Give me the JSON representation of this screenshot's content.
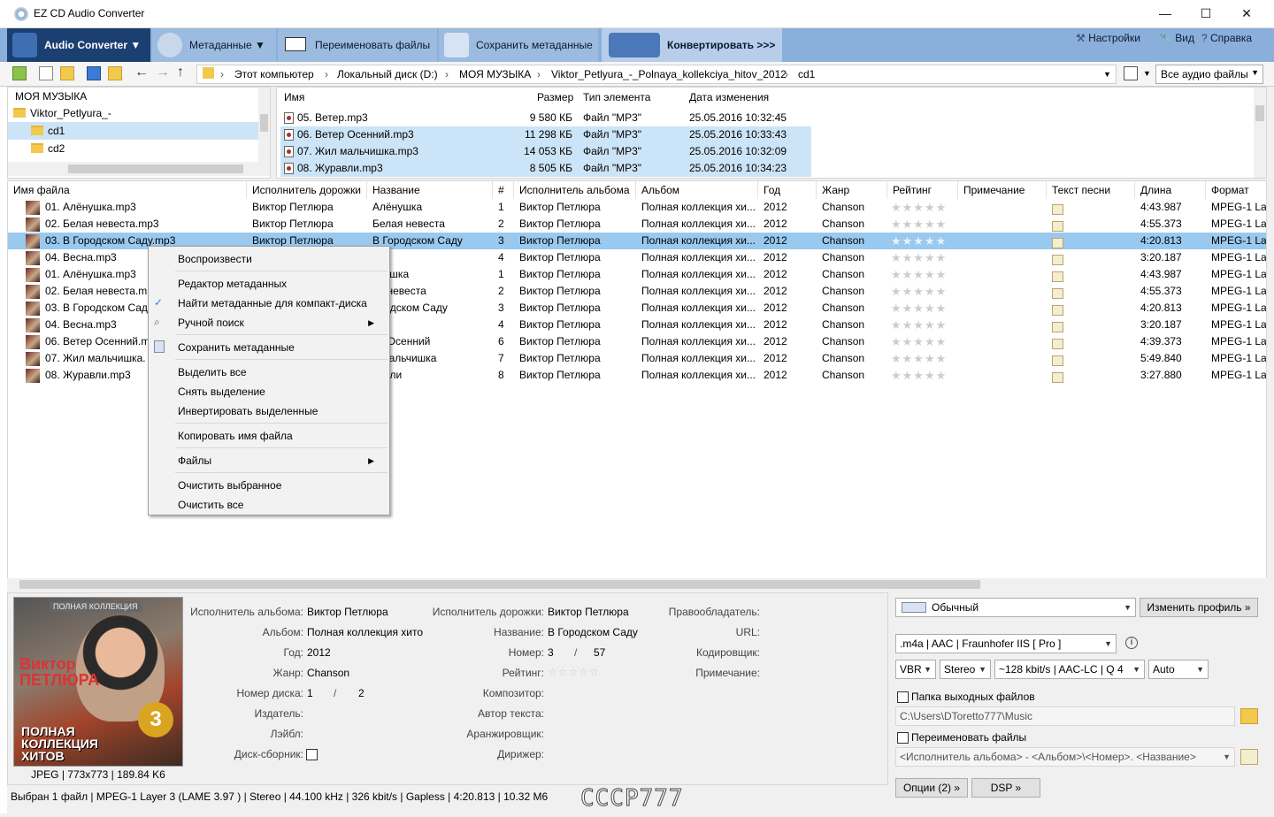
{
  "window": {
    "title": "EZ CD Audio Converter",
    "minimize": "—",
    "maximize": "☐",
    "close": "✕"
  },
  "ribbon": {
    "audio_converter": "Audio Converter ▼",
    "metadata": "Метаданные ▼",
    "rename": "Переименовать файлы",
    "save_meta": "Сохранить метаданные",
    "convert": "Конвертировать >>>",
    "settings": "Настройки",
    "view": "Вид",
    "help": "Справка"
  },
  "address": {
    "crumbs": [
      "Этот компьютер",
      "Локальный диск (D:)",
      "МОЯ МУЗЫКА",
      "Viktor_Petlyura_-_Polnaya_kollekciya_hitov_2012",
      "cd1"
    ],
    "filter": "Все аудио файлы"
  },
  "tree": {
    "root": "МОЯ МУЗЫКА",
    "folder": "Viktor_Petlyura_-_Polnaya_kollekciya_hitov_2012",
    "children": [
      "cd1",
      "cd2"
    ]
  },
  "files": {
    "headers": {
      "name": "Имя",
      "size": "Размер",
      "type": "Тип элемента",
      "date": "Дата изменения"
    },
    "rows": [
      {
        "name": "05. Ветер.mp3",
        "size": "9 580 КБ",
        "type": "Файл \"MP3\"",
        "date": "25.05.2016 10:32:45",
        "sel": false
      },
      {
        "name": "06. Ветер Осенний.mp3",
        "size": "11 298 КБ",
        "type": "Файл \"MP3\"",
        "date": "25.05.2016 10:33:43",
        "sel": true
      },
      {
        "name": "07. Жил мальчишка.mp3",
        "size": "14 053 КБ",
        "type": "Файл \"MP3\"",
        "date": "25.05.2016 10:32:09",
        "sel": true
      },
      {
        "name": "08. Журавли.mp3",
        "size": "8 505 КБ",
        "type": "Файл \"MP3\"",
        "date": "25.05.2016 10:34:23",
        "sel": true
      }
    ]
  },
  "grid": {
    "headers": [
      "Имя файла",
      "Исполнитель дорожки",
      "Название",
      "#",
      "Исполнитель альбома",
      "Альбом",
      "Год",
      "Жанр",
      "Рейтинг",
      "Примечание",
      "Текст песни",
      "Длина",
      "Формат"
    ],
    "rows": [
      {
        "file": "01. Алёнушка.mp3",
        "artist": "Виктор Петлюра",
        "title": "Алёнушка",
        "num": "1",
        "aartist": "Виктор Петлюра",
        "album": "Полная коллекция хи...",
        "year": "2012",
        "genre": "Chanson",
        "len": "4:43.987",
        "fmt": "MPEG-1 Lay"
      },
      {
        "file": "02. Белая невеста.mp3",
        "artist": "Виктор Петлюра",
        "title": "Белая невеста",
        "num": "2",
        "aartist": "Виктор Петлюра",
        "album": "Полная коллекция хи...",
        "year": "2012",
        "genre": "Chanson",
        "len": "4:55.373",
        "fmt": "MPEG-1 Lay"
      },
      {
        "file": "03. В Городском Саду.mp3",
        "artist": "Виктор Петлюра",
        "title": "В Городском Саду",
        "num": "3",
        "aartist": "Виктор Петлюра",
        "album": "Полная коллекция хи...",
        "year": "2012",
        "genre": "Chanson",
        "len": "4:20.813",
        "fmt": "MPEG-1 Lay",
        "sel": true
      },
      {
        "file": "04. Весна.mp3",
        "artist": "",
        "title": "на",
        "num": "4",
        "aartist": "Виктор Петлюра",
        "album": "Полная коллекция хи...",
        "year": "2012",
        "genre": "Chanson",
        "len": "3:20.187",
        "fmt": "MPEG-1 Lay"
      },
      {
        "file": "01. Алёнушка.mp3",
        "artist": "",
        "title": "ёнушка",
        "num": "1",
        "aartist": "Виктор Петлюра",
        "album": "Полная коллекция хи...",
        "year": "2012",
        "genre": "Chanson",
        "len": "4:43.987",
        "fmt": "MPEG-1 Lay"
      },
      {
        "file": "02. Белая невеста.mp",
        "artist": "",
        "title": "ая невеста",
        "num": "2",
        "aartist": "Виктор Петлюра",
        "album": "Полная коллекция хи...",
        "year": "2012",
        "genre": "Chanson",
        "len": "4:55.373",
        "fmt": "MPEG-1 Lay"
      },
      {
        "file": "03. В Городском Саду",
        "artist": "",
        "title": "ородском Саду",
        "num": "3",
        "aartist": "Виктор Петлюра",
        "album": "Полная коллекция хи...",
        "year": "2012",
        "genre": "Chanson",
        "len": "4:20.813",
        "fmt": "MPEG-1 Lay"
      },
      {
        "file": "04. Весна.mp3",
        "artist": "",
        "title": "на",
        "num": "4",
        "aartist": "Виктор Петлюра",
        "album": "Полная коллекция хи...",
        "year": "2012",
        "genre": "Chanson",
        "len": "3:20.187",
        "fmt": "MPEG-1 Lay"
      },
      {
        "file": "06. Ветер Осенний.m",
        "artist": "",
        "title": "ер Осенний",
        "num": "6",
        "aartist": "Виктор Петлюра",
        "album": "Полная коллекция хи...",
        "year": "2012",
        "genre": "Chanson",
        "len": "4:39.373",
        "fmt": "MPEG-1 Lay"
      },
      {
        "file": "07. Жил мальчишка.",
        "artist": "",
        "title": "л мальчишка",
        "num": "7",
        "aartist": "Виктор Петлюра",
        "album": "Полная коллекция хи...",
        "year": "2012",
        "genre": "Chanson",
        "len": "5:49.840",
        "fmt": "MPEG-1 Lay"
      },
      {
        "file": "08. Журавли.mp3",
        "artist": "",
        "title": "равли",
        "num": "8",
        "aartist": "Виктор Петлюра",
        "album": "Полная коллекция хи...",
        "year": "2012",
        "genre": "Chanson",
        "len": "3:27.880",
        "fmt": "MPEG-1 Lay"
      }
    ]
  },
  "menu": {
    "play": "Воспроизвести",
    "editor": "Редактор метаданных",
    "find_cd": "Найти метаданные для компакт-диска",
    "manual": "Ручной поиск",
    "save": "Сохранить метаданные",
    "select_all": "Выделить все",
    "deselect": "Снять выделение",
    "invert": "Инвертировать выделенные",
    "copy_name": "Копировать имя файла",
    "files": "Файлы",
    "clear_sel": "Очистить выбранное",
    "clear_all": "Очистить все"
  },
  "meta": {
    "labels": {
      "aartist": "Исполнитель альбома:",
      "album": "Альбом:",
      "year": "Год:",
      "genre": "Жанр:",
      "disc": "Номер диска:",
      "publisher": "Издатель:",
      "label": "Лэйбл:",
      "compilation": "Диск-сборник:",
      "tartist": "Исполнитель дорожки:",
      "title": "Название:",
      "number": "Номер:",
      "rating": "Рейтинг:",
      "composer": "Композитор:",
      "lyricist": "Автор текста:",
      "arranger": "Аранжировщик:",
      "conductor": "Дирижер:",
      "copyright": "Правообладатель:",
      "url": "URL:",
      "encoder": "Кодировщик:",
      "comment": "Примечание:"
    },
    "values": {
      "aartist": "Виктор Петлюра",
      "album": "Полная коллекция хито",
      "year": "2012",
      "genre": "Chanson",
      "disc": "1",
      "disc_sep": "/",
      "disc_total": "2",
      "tartist": "Виктор Петлюра",
      "title": "В Городском Саду",
      "number": "3",
      "num_sep": "/",
      "num_total": "57",
      "rating": "☆☆☆☆☆"
    },
    "cover_text": {
      "band": "ПОЛНАЯ КОЛЛЕКЦИЯ",
      "artist": "Виктор ПЕТЛЮРА",
      "badge": "3",
      "bottom": "ПОЛНАЯ КОЛЛЕКЦИЯ ХИТОВ"
    },
    "cover_info": "JPEG | 773x773 | 189.84 K6"
  },
  "status": {
    "text": "Выбран 1 файл  |  MPEG-1 Layer 3 (LAME 3.97 )  |  Stereo  |  44.100 kHz  |  326 kbit/s  |  Gapless  |  4:20.813  |  10.32 M6",
    "watermark": "CCCP777"
  },
  "right": {
    "profile": "Обычный",
    "change_profile": "Изменить профиль »",
    "codec": ".m4a  |  AAC  |  Fraunhofer IIS [ Pro ]",
    "vbr": "VBR",
    "stereo": "Stereo",
    "quality": "~128 kbit/s | AAC-LC | Q 4",
    "auto": "Auto",
    "out_folder_label": "Папка выходных файлов",
    "out_folder": "C:\\Users\\DToretto777\\Music",
    "rename_label": "Переименовать файлы",
    "rename_pattern": "<Исполнитель альбома> - <Альбом>\\<Номер>. <Название>",
    "options": "Опции (2) »",
    "dsp": "DSP »"
  }
}
